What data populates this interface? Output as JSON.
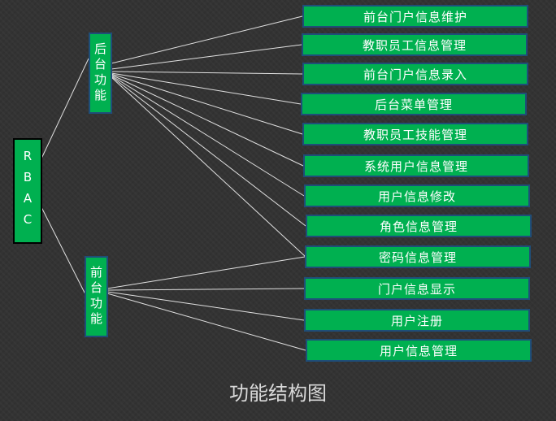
{
  "root": {
    "label": "RBAC"
  },
  "backend": {
    "label": "后台功能",
    "items": [
      "前台门户信息维护",
      "教职员工信息管理",
      "前台门户信息录入",
      "后台菜单管理",
      "教职员工技能管理",
      "系统用户信息管理",
      "用户信息修改",
      "角色信息管理",
      "密码信息管理"
    ]
  },
  "frontend": {
    "label": "前台功能",
    "items": [
      "密码信息管理",
      "门户信息显示",
      "用户注册",
      "用户信息管理"
    ]
  },
  "caption": "功能结构图",
  "colors": {
    "node_fill": "#00b050",
    "node_border": "#1f4e79",
    "line": "#e0e0e0",
    "background": "#333333"
  }
}
